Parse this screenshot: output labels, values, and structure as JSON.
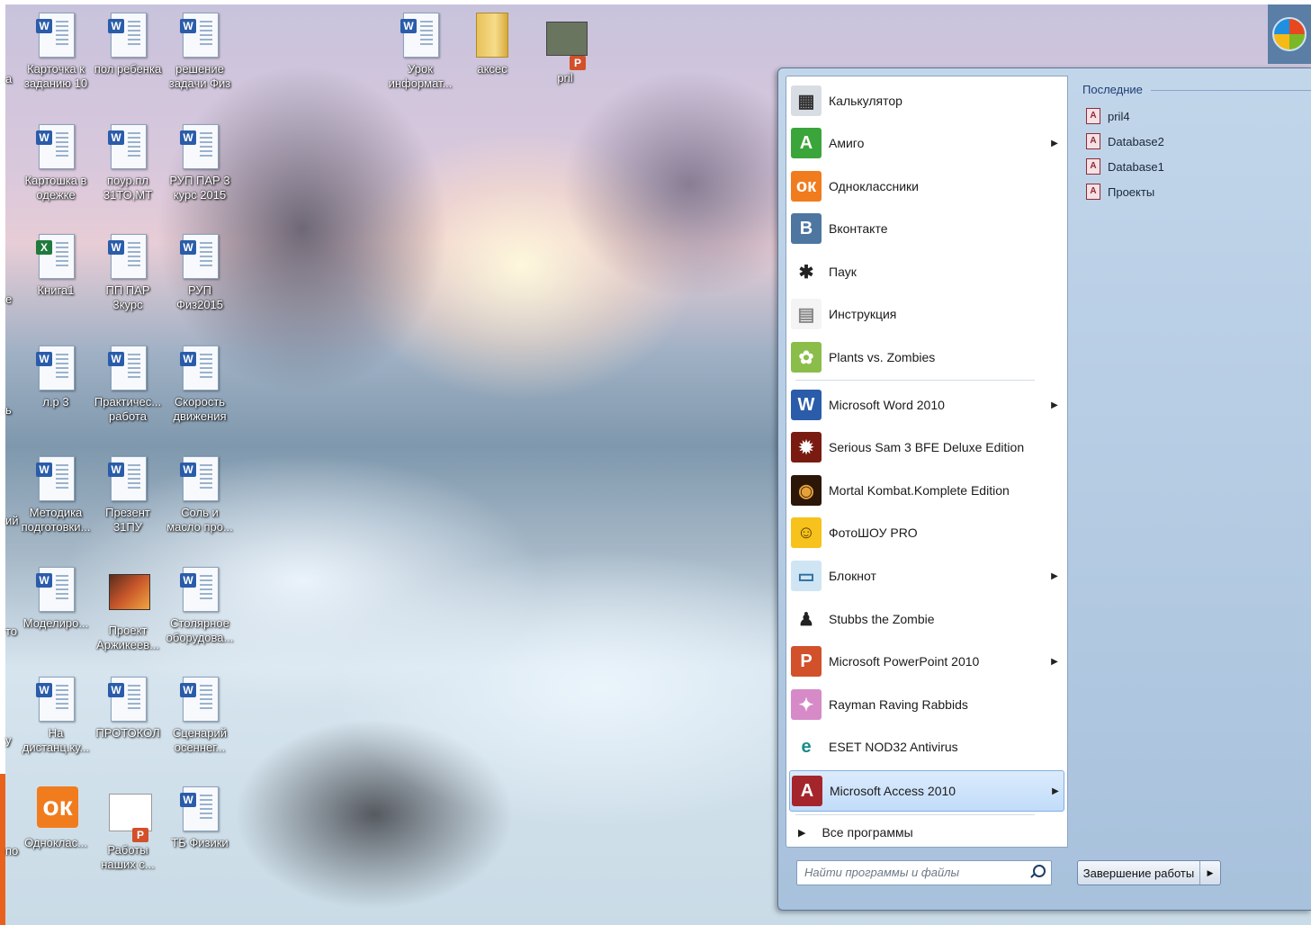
{
  "desktop": {
    "icons": [
      {
        "label": "Карточка к заданию 10",
        "type": "word"
      },
      {
        "label": "пол ребенка",
        "type": "word"
      },
      {
        "label": "решение задачи Физ",
        "type": "word"
      },
      {
        "label": "Урок информат...",
        "type": "word"
      },
      {
        "label": "аксес",
        "type": "folder"
      },
      {
        "label": "pril",
        "type": "ppt"
      },
      {
        "label": "Картошка в одежке",
        "type": "word"
      },
      {
        "label": "поур.пл 31ТО,МТ",
        "type": "word"
      },
      {
        "label": "РУП ПАР 3 курс 2015",
        "type": "word"
      },
      {
        "label": "Книга1",
        "type": "excel"
      },
      {
        "label": "ПП ПАР 3курс",
        "type": "word"
      },
      {
        "label": "РУП Физ2015",
        "type": "word"
      },
      {
        "label": "л.р 3",
        "type": "word"
      },
      {
        "label": "Практичес... работа",
        "type": "word"
      },
      {
        "label": "Скорость движения",
        "type": "word"
      },
      {
        "label": "Методика подготовки...",
        "type": "word"
      },
      {
        "label": "Презент 31ПУ",
        "type": "word"
      },
      {
        "label": "Соль и масло про...",
        "type": "word"
      },
      {
        "label": "Моделиро...",
        "type": "word"
      },
      {
        "label": "Проект Аржикеев...",
        "type": "video"
      },
      {
        "label": "Столярное оборудова...",
        "type": "word"
      },
      {
        "label": "На дистанц.ку...",
        "type": "word"
      },
      {
        "label": "ПРОТОКОЛ",
        "type": "word"
      },
      {
        "label": "Сценарий осеннег...",
        "type": "word"
      },
      {
        "label": "Одноклас...",
        "type": "ok"
      },
      {
        "label": "Работы наших с...",
        "type": "pptthumb"
      },
      {
        "label": "ТБ Физики",
        "type": "word"
      }
    ],
    "cut_labels": [
      "а",
      "е",
      "ь",
      "ий",
      "то",
      "у",
      "по"
    ]
  },
  "start_menu": {
    "programs": [
      {
        "label": "Калькулятор",
        "icon": "calculator-icon",
        "submenu": false
      },
      {
        "label": "Амиго",
        "icon": "amigo-icon",
        "submenu": true
      },
      {
        "label": "Одноклассники",
        "icon": "odnoklassniki-icon",
        "submenu": false
      },
      {
        "label": "Вконтакте",
        "icon": "vkontakte-icon",
        "submenu": false
      },
      {
        "label": "Паук",
        "icon": "spider-icon",
        "submenu": false
      },
      {
        "label": "Инструкция",
        "icon": "document-icon",
        "submenu": false
      },
      {
        "label": "Plants vs. Zombies",
        "icon": "plants-vs-zombies-icon",
        "submenu": false
      },
      {
        "label": "Microsoft Word 2010",
        "icon": "word-icon",
        "submenu": true
      },
      {
        "label": "Serious Sam 3 BFE Deluxe Edition",
        "icon": "serious-sam-icon",
        "submenu": false
      },
      {
        "label": "Mortal Kombat.Komplete Edition",
        "icon": "mortal-kombat-icon",
        "submenu": false
      },
      {
        "label": "ФотоШОУ PRO",
        "icon": "fotoshow-icon",
        "submenu": false
      },
      {
        "label": "Блокнот",
        "icon": "notepad-icon",
        "submenu": true
      },
      {
        "label": "Stubbs the Zombie",
        "icon": "stubbs-icon",
        "submenu": false
      },
      {
        "label": "Microsoft PowerPoint 2010",
        "icon": "powerpoint-icon",
        "submenu": true
      },
      {
        "label": "Rayman Raving Rabbids",
        "icon": "rayman-icon",
        "submenu": false
      },
      {
        "label": "ESET NOD32 Antivirus",
        "icon": "eset-icon",
        "submenu": false
      },
      {
        "label": "Microsoft Access 2010",
        "icon": "access-icon",
        "submenu": true,
        "selected": true
      }
    ],
    "all_programs_label": "Все программы",
    "search_placeholder": "Найти программы и файлы",
    "recent_title": "Последние",
    "recent_items": [
      "pril4",
      "Database2",
      "Database1",
      "Проекты"
    ],
    "shutdown_label": "Завершение работы"
  },
  "colors": {
    "accent": "#7f9cbf",
    "selected": "#c1dcfa",
    "orange_strip": "#e8621e"
  }
}
